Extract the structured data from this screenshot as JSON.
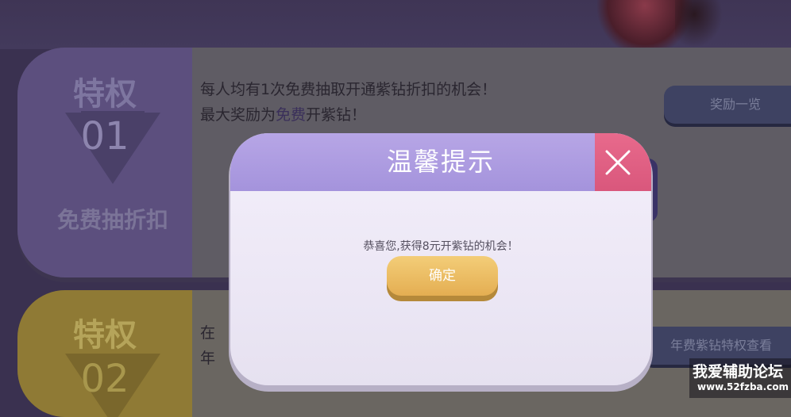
{
  "privilege1": {
    "label": "特权",
    "number": "01",
    "subtitle": "免费抽折扣",
    "line1": "每人均有1次免费抽取开通紫钻折扣的机会！",
    "line2_prefix": "最大奖励为",
    "line2_highlight": "免费",
    "line2_suffix": "开紫钻！",
    "button": "奖励一览"
  },
  "privilege2": {
    "label": "特权",
    "number": "02",
    "line1_partial": "在",
    "line2_partial": "年",
    "button": "年费紫钻特权查看"
  },
  "modal": {
    "title": "温馨提示",
    "message": "恭喜您,获得8元开紫钻的机会！",
    "confirm": "确定",
    "close_icon": "close-x-icon",
    "header_color": "#a898de",
    "close_color": "#e0607f",
    "confirm_color": "#ecbc60"
  },
  "watermark": {
    "title": "我爱辅助论坛",
    "url": "www.52fzba.com"
  }
}
